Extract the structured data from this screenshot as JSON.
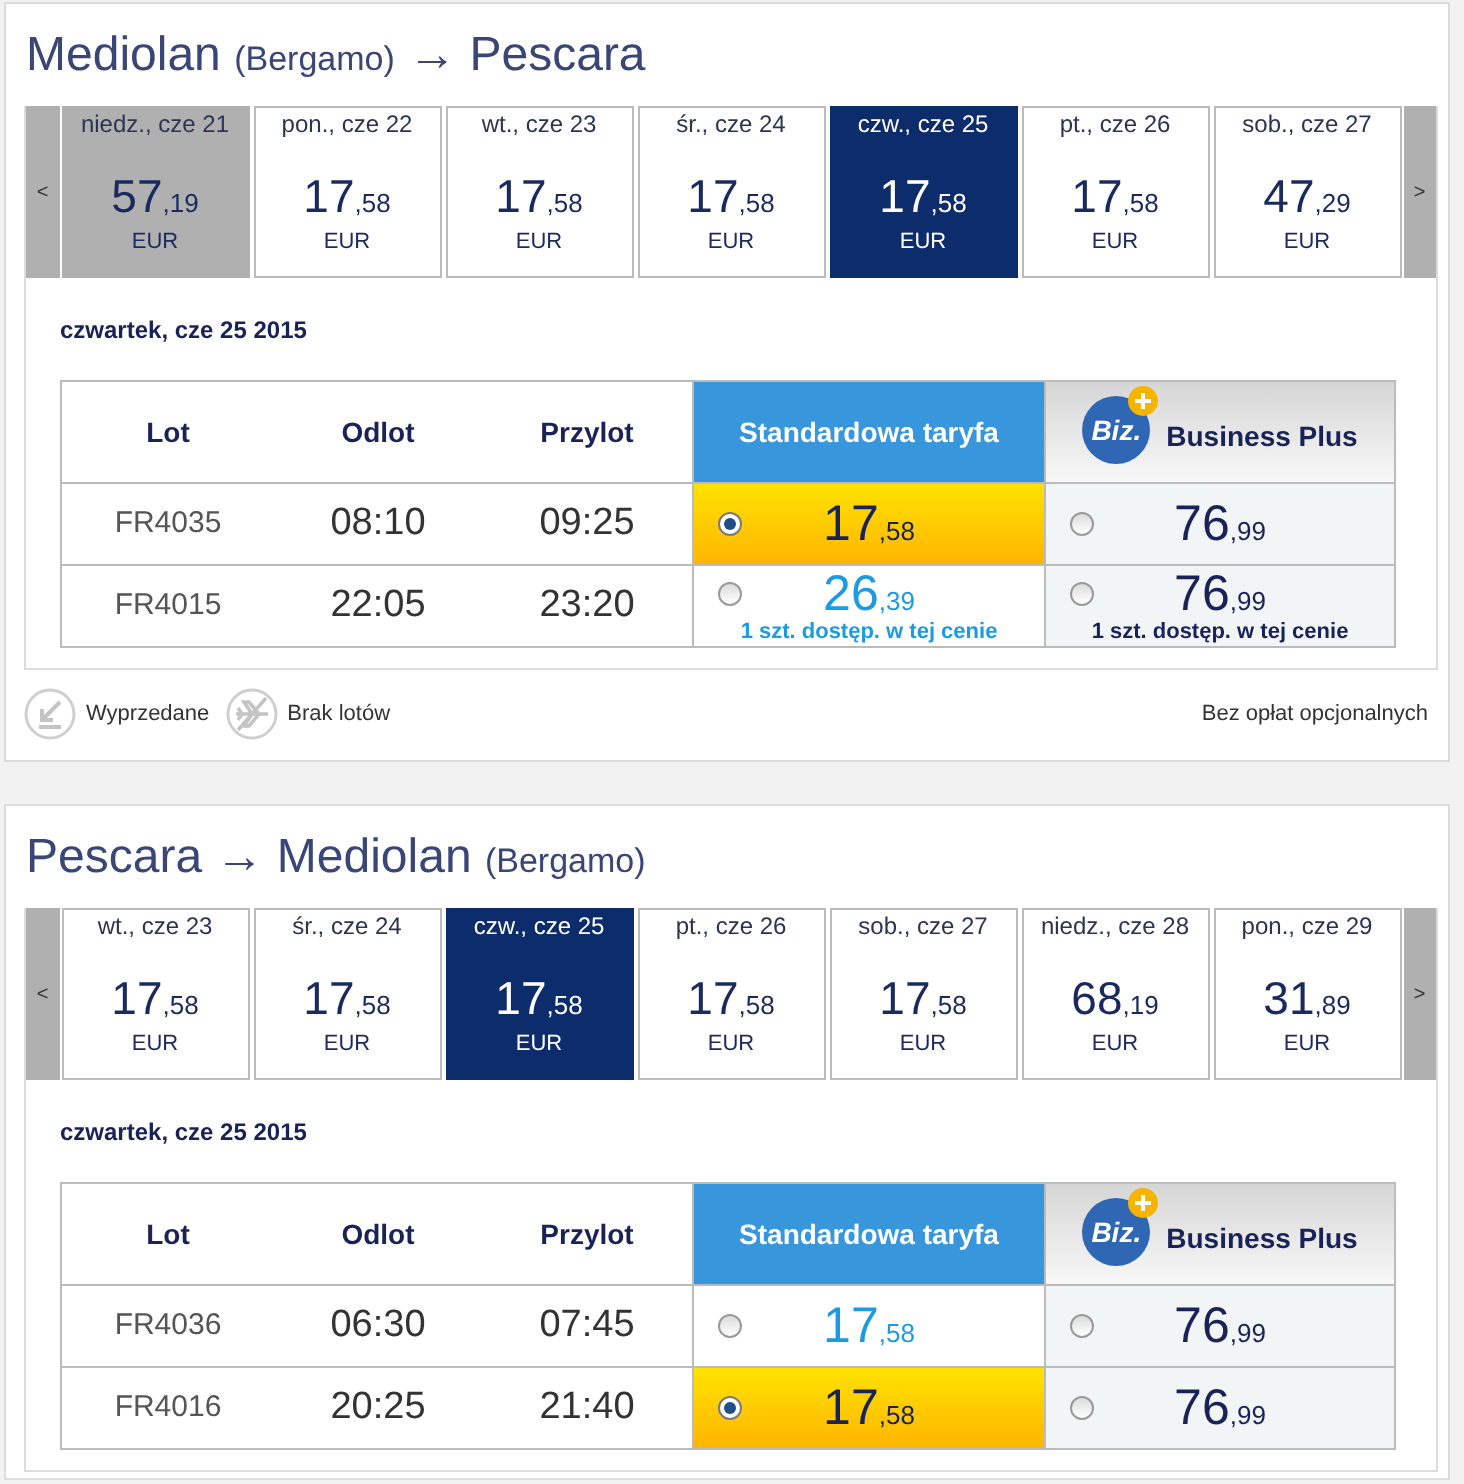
{
  "sections": [
    {
      "title": {
        "origin": {
          "city": "Mediolan",
          "airport": "(Bergamo)"
        },
        "arrow": "→",
        "destination": {
          "city": "Pescara"
        }
      },
      "date_strip": {
        "prev": "<",
        "next": ">",
        "days": [
          {
            "label": "niedz., cze 21",
            "price": "57",
            "cents": ",19",
            "currency": "EUR",
            "selected": false,
            "disabled": true
          },
          {
            "label": "pon., cze 22",
            "price": "17",
            "cents": ",58",
            "currency": "EUR",
            "selected": false,
            "disabled": false
          },
          {
            "label": "wt., cze 23",
            "price": "17",
            "cents": ",58",
            "currency": "EUR",
            "selected": false,
            "disabled": false
          },
          {
            "label": "śr., cze 24",
            "price": "17",
            "cents": ",58",
            "currency": "EUR",
            "selected": false,
            "disabled": false
          },
          {
            "label": "czw., cze 25",
            "price": "17",
            "cents": ",58",
            "currency": "EUR",
            "selected": true,
            "disabled": false
          },
          {
            "label": "pt., cze 26",
            "price": "17",
            "cents": ",58",
            "currency": "EUR",
            "selected": false,
            "disabled": false
          },
          {
            "label": "sob., cze 27",
            "price": "47",
            "cents": ",29",
            "currency": "EUR",
            "selected": false,
            "disabled": false
          }
        ]
      },
      "selected_date": "czwartek, cze 25 2015",
      "table": {
        "columns": [
          {
            "label": "Lot",
            "kind": "text"
          },
          {
            "label": "Odlot",
            "kind": "text"
          },
          {
            "label": "Przylot",
            "kind": "text"
          },
          {
            "label": "Standardowa taryfa",
            "kind": "standard"
          },
          {
            "label": "Business Plus",
            "kind": "business",
            "logo": "Biz."
          }
        ],
        "rows": [
          {
            "flight": "FR4035",
            "departure": "08:10",
            "arrival": "09:25",
            "fares": [
              {
                "price": "17",
                "cents": ",58",
                "selected": true
              },
              {
                "price": "76",
                "cents": ",99",
                "selected": false
              }
            ]
          },
          {
            "flight": "FR4015",
            "departure": "22:05",
            "arrival": "23:20",
            "fares": [
              {
                "price": "26",
                "cents": ",39",
                "selected": false,
                "note": "1 szt. dostęp. w tej cenie"
              },
              {
                "price": "76",
                "cents": ",99",
                "selected": false,
                "note": "1 szt. dostęp. w tej cenie"
              }
            ]
          }
        ]
      },
      "legend": {
        "items": [
          {
            "label": "Wyprzedane",
            "kind": "sold_out"
          },
          {
            "label": "Brak lotów",
            "kind": "no_flights"
          }
        ],
        "note": "Bez opłat opcjonalnych"
      }
    },
    {
      "title": {
        "origin": {
          "city": "Pescara"
        },
        "arrow": "→",
        "destination": {
          "city": "Mediolan",
          "airport": "(Bergamo)"
        }
      },
      "date_strip": {
        "prev": "<",
        "next": ">",
        "days": [
          {
            "label": "wt., cze 23",
            "price": "17",
            "cents": ",58",
            "currency": "EUR",
            "selected": false,
            "disabled": false
          },
          {
            "label": "śr., cze 24",
            "price": "17",
            "cents": ",58",
            "currency": "EUR",
            "selected": false,
            "disabled": false
          },
          {
            "label": "czw., cze 25",
            "price": "17",
            "cents": ",58",
            "currency": "EUR",
            "selected": true,
            "disabled": false
          },
          {
            "label": "pt., cze 26",
            "price": "17",
            "cents": ",58",
            "currency": "EUR",
            "selected": false,
            "disabled": false
          },
          {
            "label": "sob., cze 27",
            "price": "17",
            "cents": ",58",
            "currency": "EUR",
            "selected": false,
            "disabled": false
          },
          {
            "label": "niedz., cze 28",
            "price": "68",
            "cents": ",19",
            "currency": "EUR",
            "selected": false,
            "disabled": false
          },
          {
            "label": "pon., cze 29",
            "price": "31",
            "cents": ",89",
            "currency": "EUR",
            "selected": false,
            "disabled": false
          }
        ]
      },
      "selected_date": "czwartek, cze 25 2015",
      "table": {
        "columns": [
          {
            "label": "Lot",
            "kind": "text"
          },
          {
            "label": "Odlot",
            "kind": "text"
          },
          {
            "label": "Przylot",
            "kind": "text"
          },
          {
            "label": "Standardowa taryfa",
            "kind": "standard"
          },
          {
            "label": "Business Plus",
            "kind": "business",
            "logo": "Biz."
          }
        ],
        "rows": [
          {
            "flight": "FR4036",
            "departure": "06:30",
            "arrival": "07:45",
            "fares": [
              {
                "price": "17",
                "cents": ",58",
                "selected": false
              },
              {
                "price": "76",
                "cents": ",99",
                "selected": false
              }
            ]
          },
          {
            "flight": "FR4016",
            "departure": "20:25",
            "arrival": "21:40",
            "fares": [
              {
                "price": "17",
                "cents": ",58",
                "selected": true
              },
              {
                "price": "76",
                "cents": ",99",
                "selected": false
              }
            ]
          }
        ]
      }
    }
  ]
}
